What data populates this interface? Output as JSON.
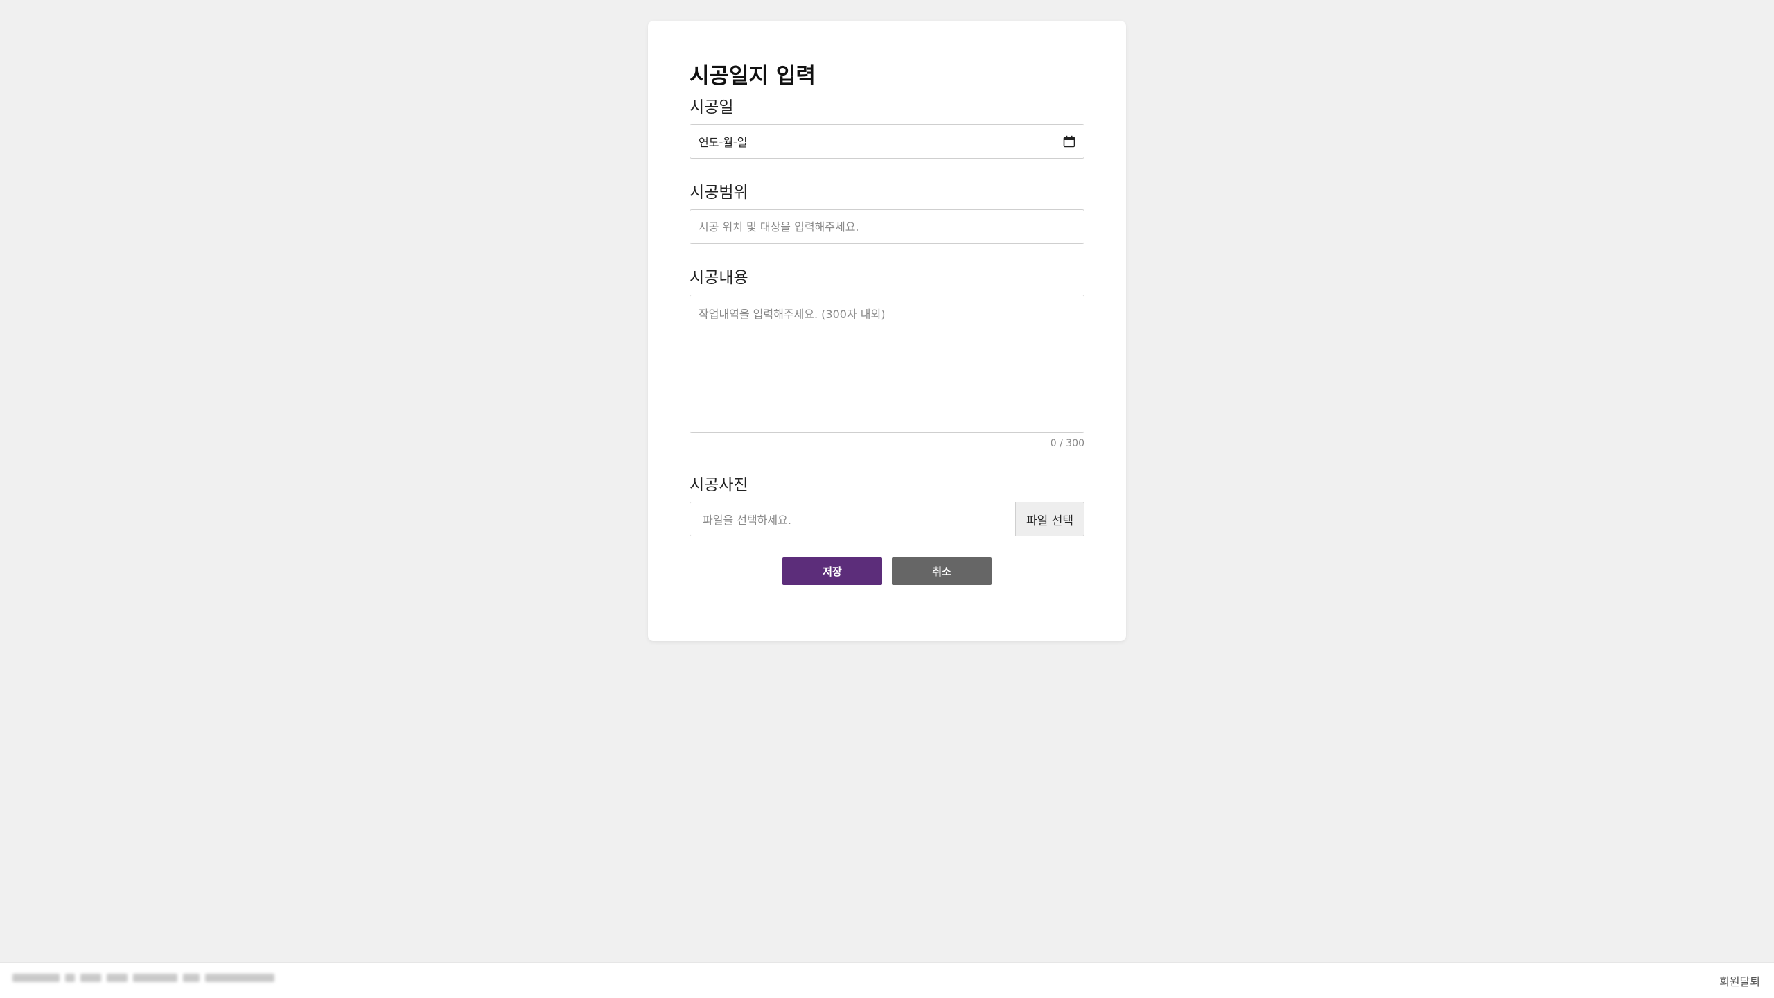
{
  "form": {
    "title": "시공일지 입력",
    "date": {
      "label": "시공일",
      "value": "연도-월-일",
      "icon": "calendar-icon"
    },
    "scope": {
      "label": "시공범위",
      "placeholder": "시공 위치 및 대상을 입력해주세요."
    },
    "content": {
      "label": "시공내용",
      "placeholder": "작업내역을 입력해주세요. (300자 내외)",
      "counter": "0 / 300"
    },
    "photo": {
      "label": "시공사진",
      "file_placeholder": "파일을 선택하세요.",
      "button_label": "파일 선택"
    },
    "actions": {
      "save_label": "저장",
      "cancel_label": "취소"
    }
  },
  "footer": {
    "withdraw_label": "회원탈퇴"
  },
  "colors": {
    "background": "#f0f0f0",
    "card": "#ffffff",
    "save_button": "#5c2d7a",
    "cancel_button": "#666666",
    "input_border": "#cfcfcf"
  }
}
